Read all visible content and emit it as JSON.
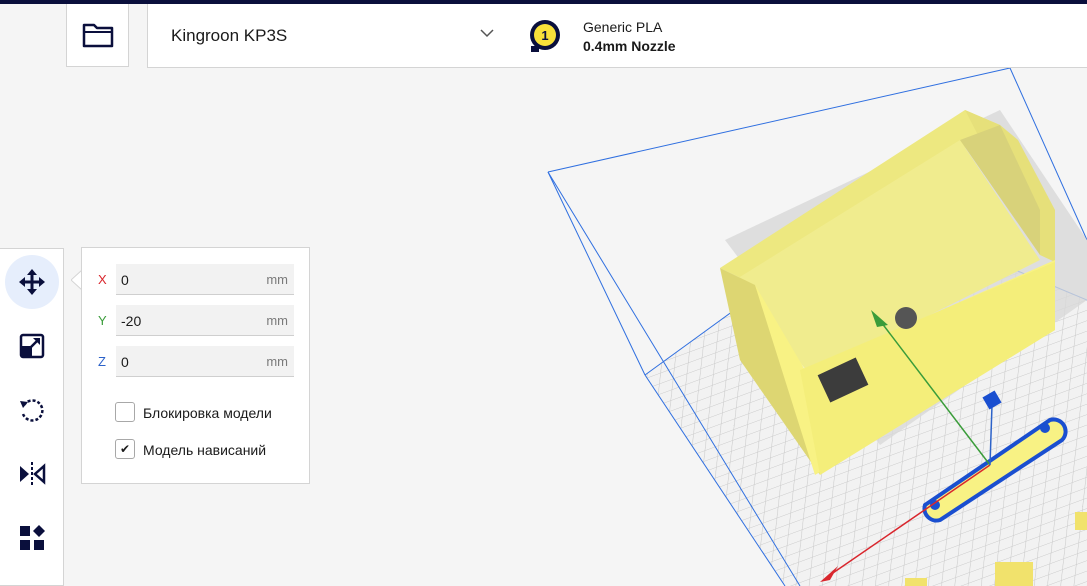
{
  "header": {
    "printer": {
      "name": "Kingroon KP3S"
    },
    "material": {
      "extruder_index": "1",
      "name": "Generic PLA",
      "nozzle": "0.4mm Nozzle"
    }
  },
  "toolbar": {
    "tools": [
      {
        "name": "move",
        "icon": "move-arrows-icon",
        "active": true
      },
      {
        "name": "scale",
        "icon": "scale-icon",
        "active": false
      },
      {
        "name": "rotate",
        "icon": "rotate-icon",
        "active": false
      },
      {
        "name": "mirror",
        "icon": "mirror-icon",
        "active": false
      },
      {
        "name": "per-model-settings",
        "icon": "per-model-settings-icon",
        "active": false
      }
    ]
  },
  "move_panel": {
    "x": {
      "label": "X",
      "value": "0",
      "unit": "mm",
      "color": "#d9262d"
    },
    "y": {
      "label": "Y",
      "value": "-20",
      "unit": "mm",
      "color": "#3a9c3a"
    },
    "z": {
      "label": "Z",
      "value": "0",
      "unit": "mm",
      "color": "#2c62c9"
    },
    "lock_model": {
      "label": "Блокировка модели",
      "checked": false
    },
    "drop_down": {
      "label": "Модель нависаний",
      "checked": true,
      "mark": "✔"
    }
  },
  "colors": {
    "accent": "#196ef0",
    "model": "#f8f284",
    "topbar": "#0a0f3c"
  }
}
